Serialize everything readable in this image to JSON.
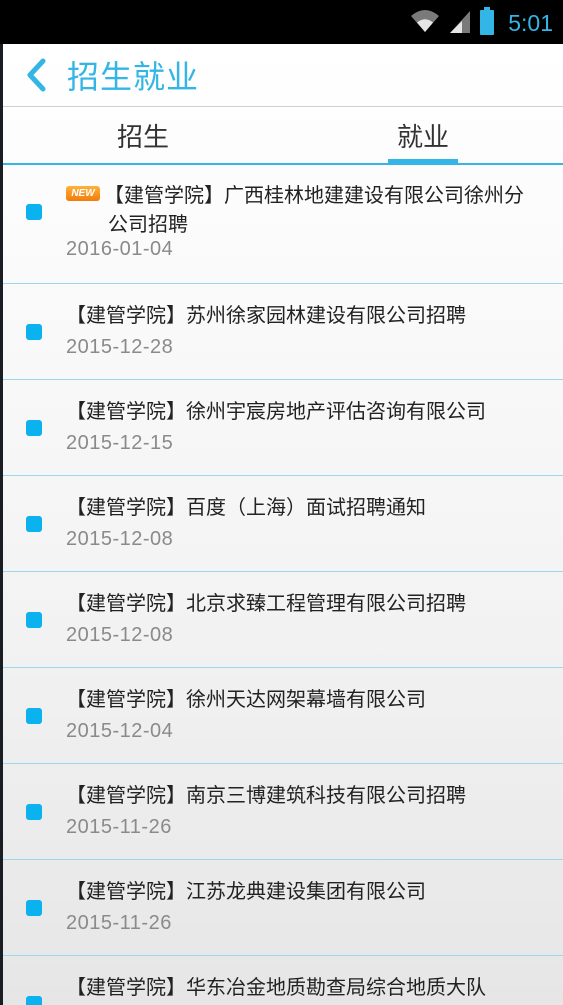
{
  "status_bar": {
    "time": "5:01",
    "icons": [
      "wifi-icon",
      "signal-icon",
      "battery-icon"
    ]
  },
  "header": {
    "title": "招生就业",
    "back_icon": "chevron-left-icon"
  },
  "tabs": [
    {
      "label": "招生",
      "active": false
    },
    {
      "label": "就业",
      "active": true
    }
  ],
  "colors": {
    "accent": "#33b5e5",
    "bullet": "#0ab2ef",
    "badge": "#f39a1f"
  },
  "list": [
    {
      "badge": "NEW",
      "title_line1": "【建管学院】广西桂林地建建设有限公司徐州分",
      "title_line2": "公司招聘",
      "date": "2016-01-04"
    },
    {
      "title": "【建管学院】苏州徐家园林建设有限公司招聘",
      "date": "2015-12-28"
    },
    {
      "title": "【建管学院】徐州宇宸房地产评估咨询有限公司",
      "date": "2015-12-15"
    },
    {
      "title": "【建管学院】百度（上海）面试招聘通知",
      "date": "2015-12-08"
    },
    {
      "title": "【建管学院】北京求臻工程管理有限公司招聘",
      "date": "2015-12-08"
    },
    {
      "title": "【建管学院】徐州天达网架幕墙有限公司",
      "date": "2015-12-04"
    },
    {
      "title": "【建管学院】南京三博建筑科技有限公司招聘",
      "date": "2015-11-26"
    },
    {
      "title": "【建管学院】江苏龙典建设集团有限公司",
      "date": "2015-11-26"
    },
    {
      "title": "【建管学院】华东冶金地质勘查局综合地质大队",
      "date": ""
    }
  ]
}
